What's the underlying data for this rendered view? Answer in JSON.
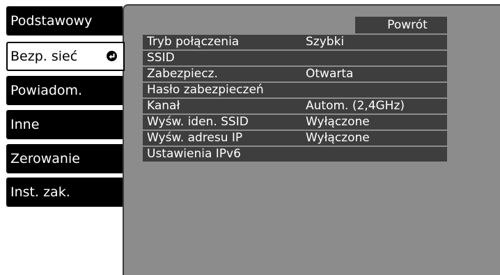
{
  "sidebar": {
    "items": [
      {
        "label": "Podstawowy"
      },
      {
        "label": "Bezp. sieć"
      },
      {
        "label": "Powiadom."
      },
      {
        "label": "Inne"
      },
      {
        "label": "Zerowanie"
      },
      {
        "label": "Inst. zak."
      }
    ],
    "selected_index": 1,
    "selected_icon": "enter-icon"
  },
  "panel": {
    "back_label": "Powrót",
    "settings": [
      {
        "label": "Tryb połączenia",
        "value": "Szybki"
      },
      {
        "label": "SSID",
        "value": ""
      },
      {
        "label": "Zabezpiecz.",
        "value": "Otwarta"
      },
      {
        "label": "Hasło zabezpieczeń",
        "value": ""
      },
      {
        "label": "Kanał",
        "value": "Autom. (2,4GHz)"
      },
      {
        "label": "Wyśw. iden. SSID",
        "value": "Wyłączone"
      },
      {
        "label": "Wyśw. adresu IP",
        "value": "Wyłączone"
      },
      {
        "label": "Ustawienia IPv6",
        "value": ""
      }
    ]
  },
  "colors": {
    "menu_bg": "#000000",
    "menu_text": "#ffffff",
    "panel_bg": "#8c8c8c",
    "row_bg": "#3e3e3e"
  }
}
